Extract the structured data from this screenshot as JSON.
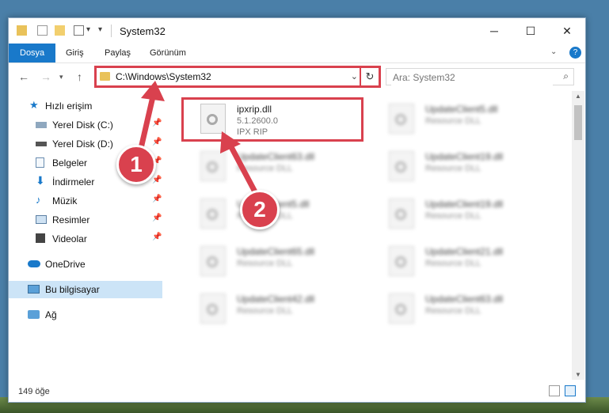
{
  "window": {
    "title": "System32"
  },
  "ribbon": {
    "tabs": [
      {
        "label": "Dosya"
      },
      {
        "label": "Giriş"
      },
      {
        "label": "Paylaş"
      },
      {
        "label": "Görünüm"
      }
    ]
  },
  "address": {
    "path": "C:\\Windows\\System32"
  },
  "search": {
    "placeholder": "Ara: System32"
  },
  "sidebar": {
    "items": [
      {
        "label": "Hızlı erişim"
      },
      {
        "label": "Yerel Disk (C:)"
      },
      {
        "label": "Yerel Disk (D:)"
      },
      {
        "label": "Belgeler"
      },
      {
        "label": "İndirmeler"
      },
      {
        "label": "Müzik"
      },
      {
        "label": "Resimler"
      },
      {
        "label": "Videolar"
      },
      {
        "label": "OneDrive"
      },
      {
        "label": "Bu bilgisayar"
      },
      {
        "label": "Ağ"
      }
    ]
  },
  "files": [
    {
      "name": "ipxrip.dll",
      "version": "5.1.2600.0",
      "desc": "IPX RIP"
    },
    {
      "name": "UpdateClient5.dll",
      "desc": "Resource DLL"
    },
    {
      "name": "UpdateClient63.dll",
      "desc": "Resource DLL"
    },
    {
      "name": "UpdateClient19.dll",
      "desc": "Resource DLL"
    },
    {
      "name": "UpdateClient5.dll",
      "desc": "Resource DLL"
    },
    {
      "name": "UpdateClient19.dll",
      "desc": "Resource DLL"
    },
    {
      "name": "UpdateClient65.dll",
      "desc": "Resource DLL"
    },
    {
      "name": "UpdateClient21.dll",
      "desc": "Resource DLL"
    },
    {
      "name": "UpdateClient42.dll",
      "desc": "Resource DLL"
    },
    {
      "name": "UpdateClient63.dll",
      "desc": "Resource DLL"
    }
  ],
  "status": {
    "count": "149 öğe"
  },
  "callouts": [
    "1",
    "2"
  ],
  "colors": {
    "accent": "#1979ca",
    "highlight": "#d9414e"
  }
}
